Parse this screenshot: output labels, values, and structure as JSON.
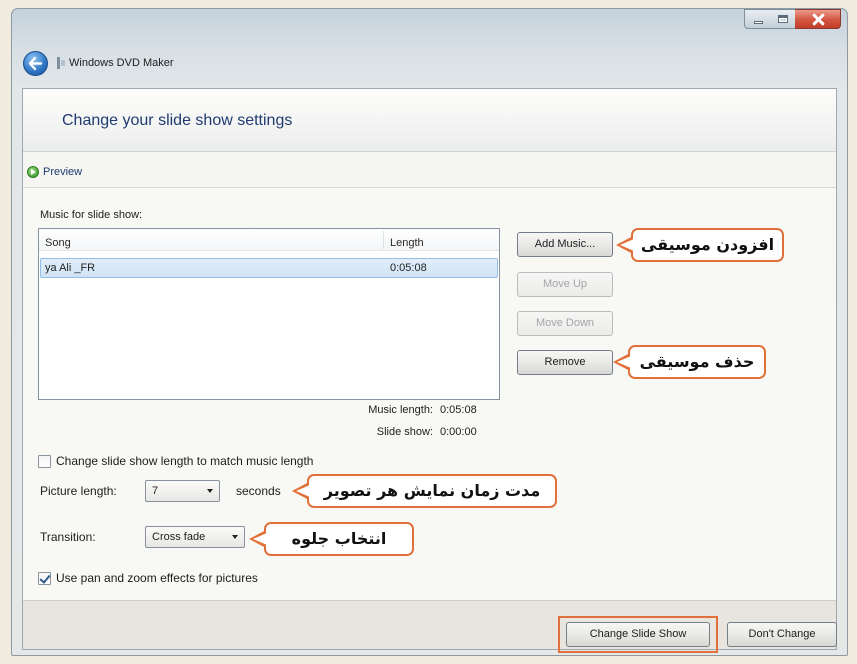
{
  "window": {
    "title": "Windows DVD Maker"
  },
  "header": {
    "title": "Change your slide show settings"
  },
  "preview": {
    "label": "Preview"
  },
  "music": {
    "section_label": "Music for slide show:",
    "columns": [
      "Song",
      "Length"
    ],
    "rows": [
      {
        "song": "ya Ali _FR",
        "length": "0:05:08",
        "selected": true
      }
    ],
    "buttons": {
      "add": {
        "label": "Add Music...",
        "disabled": false
      },
      "move_up": {
        "label": "Move Up",
        "disabled": true
      },
      "move_down": {
        "label": "Move Down",
        "disabled": true
      },
      "remove": {
        "label": "Remove",
        "disabled": false
      }
    },
    "music_length_label": "Music length:",
    "music_length_value": "0:05:08",
    "slide_show_label": "Slide show:",
    "slide_show_value": "0:00:00"
  },
  "options": {
    "match_length": {
      "label": "Change slide show length to match music length",
      "checked": false
    },
    "picture_length": {
      "label": "Picture length:",
      "value": "7",
      "unit": "seconds"
    },
    "transition": {
      "label": "Transition:",
      "value": "Cross fade"
    },
    "pan_zoom": {
      "label": "Use pan and zoom effects for pictures",
      "checked": true
    }
  },
  "footer": {
    "change_button": "Change Slide Show",
    "dont_change_button": "Don't Change"
  },
  "annotations": {
    "add_music": "افزودن موسیقی",
    "remove_music": "حذف موسیقی",
    "picture_length": "مدت زمان نمایش هر تصویر",
    "transition": "انتخاب جلوه"
  },
  "icons": {
    "back": "back-arrow-icon",
    "app": "dvd-maker-icon",
    "preview": "play-icon",
    "minimize": "minimize-icon",
    "maximize": "maximize-icon",
    "close": "close-icon",
    "dropdown": "chevron-down-icon",
    "checkbox": "checkmark-icon"
  },
  "colors": {
    "header_text": "#1f3b70",
    "callout_border": "#e2703a",
    "selection": "#cfe3f6",
    "close_button": "#c9473a"
  }
}
